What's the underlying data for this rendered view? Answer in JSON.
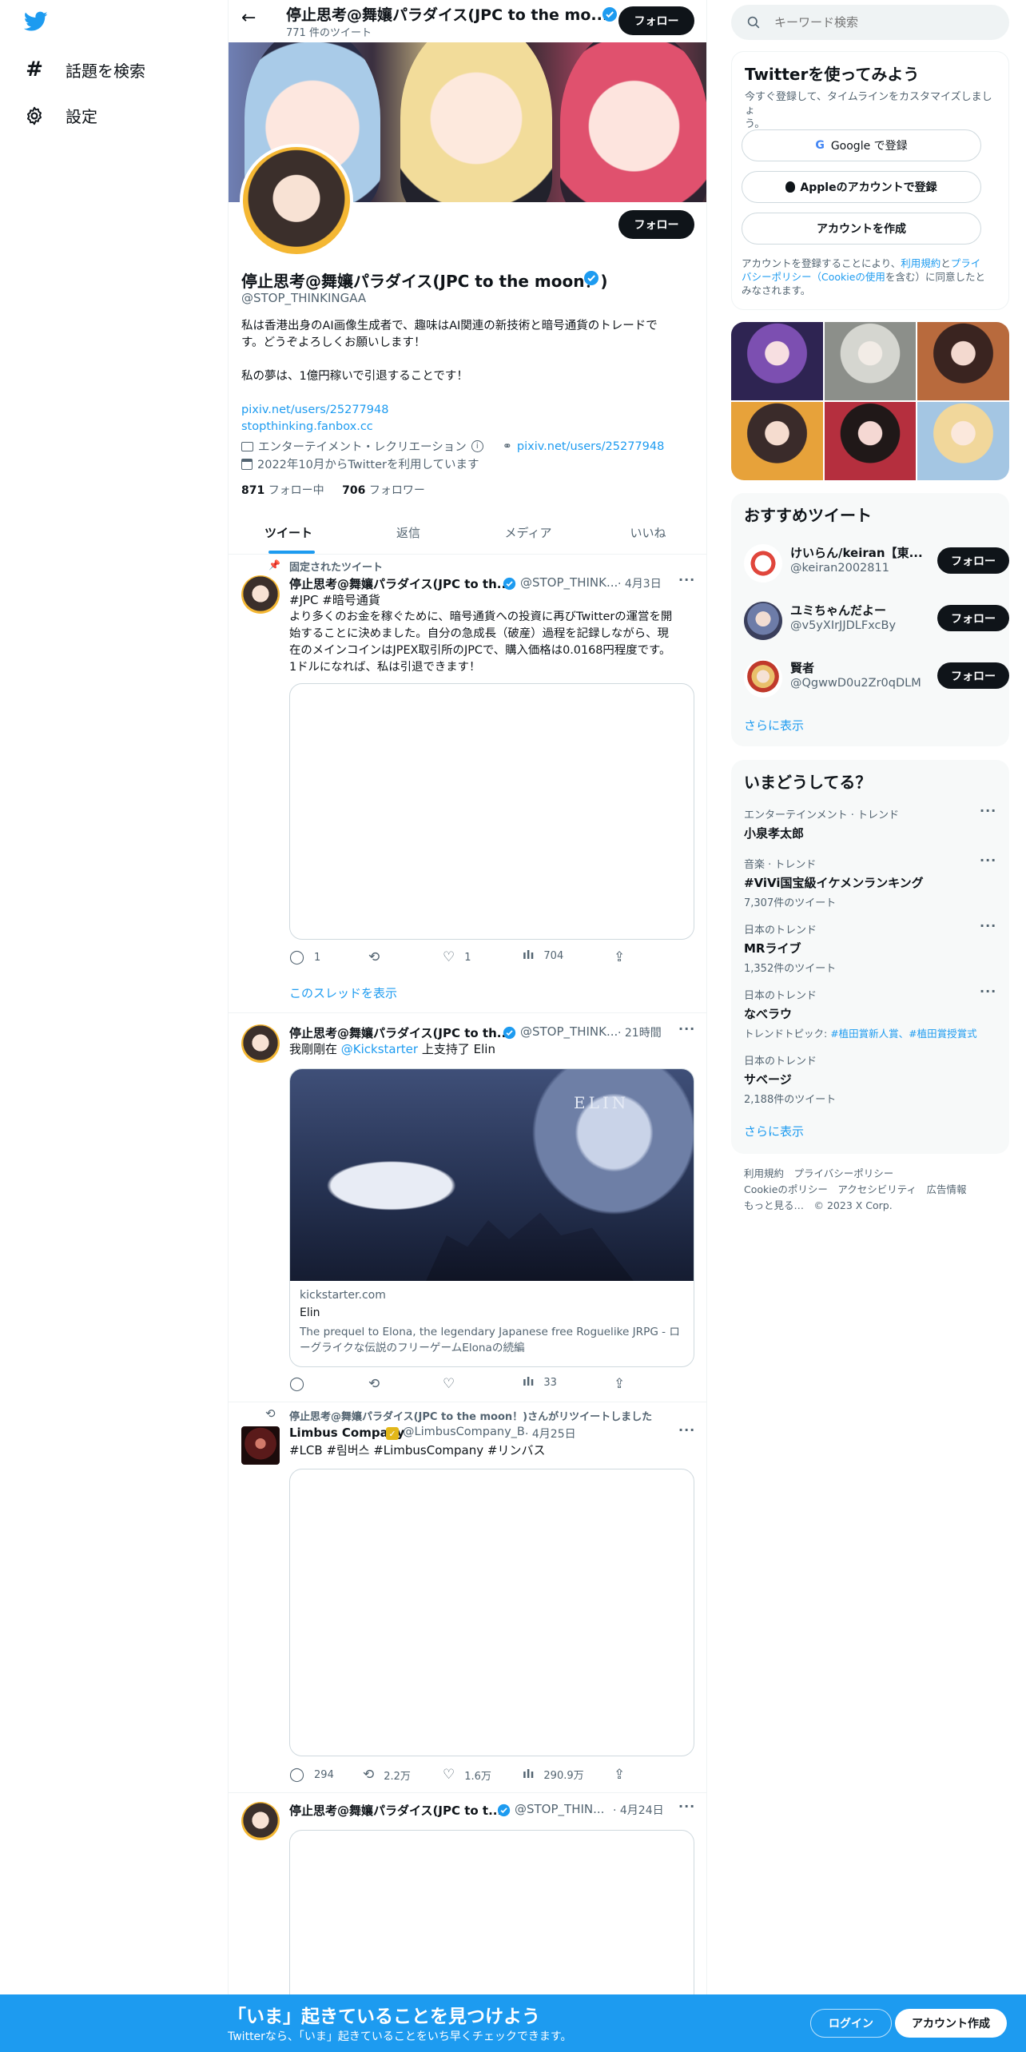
{
  "nav": {
    "explore_label": "話題を検索",
    "settings_label": "設定"
  },
  "header": {
    "name": "停止思考@舞孃パラダイス(JPC to the mo...",
    "tweet_count": "771 件のツイート",
    "follow_label": "フォロー"
  },
  "profile": {
    "follow_label": "フォロー",
    "name": "停止思考@舞孃パラダイス(JPC to the moon！)",
    "handle": "@STOP_THINKINGAA",
    "bio_line1": "私は香港出身のAI画像生成者で、趣味はAI関連の新技術と暗号通貨のトレードで",
    "bio_line2": "す。どうぞよろしくお願いします！",
    "bio_line3": "私の夢は、1億円稼いで引退することです！",
    "link1": "pixiv.net/users/25277948",
    "link2": "stopthinking.fanbox.cc",
    "category": "エンターテイメント・レクリエーション",
    "website": "pixiv.net/users/25277948",
    "joined": "2022年10月からTwitterを利用しています",
    "following_count": "871",
    "following_label": "フォロー中",
    "followers_count": "706",
    "followers_label": "フォロワー"
  },
  "tabs": [
    "ツイート",
    "返信",
    "メディア",
    "いいね"
  ],
  "tweets": [
    {
      "pinned_label": "固定されたツイート",
      "name": "停止思考@舞孃パラダイス(JPC to th...",
      "handle": "@STOP_THINK...",
      "time": "· 4月3日",
      "hashtags": "#JPC #暗号通貨",
      "text_line1": "より多くのお金を稼ぐために、暗号通貨への投資に再びTwitterの運営を開",
      "text_line2": "始することに決めました。自分の急成長（破産）過程を記録しながら、現",
      "text_line3": "在のメインコインはJPEX取引所のJPCで、購入価格は0.0168円程度です。",
      "text_line4": "1ドルになれば、私は引退できます！",
      "replies": "1",
      "likes": "1",
      "views": "704",
      "thread_link": "このスレッドを表示"
    },
    {
      "name": "停止思考@舞孃パラダイス(JPC to th...",
      "handle": "@STOP_THINK...",
      "time": "· 21時間",
      "text_prefix": "我剛剛在",
      "text_mention": "@Kickstarter",
      "text_suffix": "上支持了 Elin",
      "card_image_text": "ELIN",
      "card_domain": "kickstarter.com",
      "card_title": "Elin",
      "card_desc_line1": "The prequel to Elona, the legendary Japanese free Roguelike JRPG - ロ",
      "card_desc_line2": "ーグライクな伝説のフリーゲームElonaの続編",
      "views": "33"
    },
    {
      "retweet_label": "停止思考@舞孃パラダイス(JPC to the moon！)さんがリツイートしました",
      "name": "Limbus Company",
      "handle": "@LimbusCompany_B",
      "time": "· 4月25日",
      "hashtags": "#LCB #림버스 #LimbusCompany #リンバス",
      "replies": "294",
      "retweets": "2.2万",
      "likes": "1.6万",
      "views": "290.9万"
    },
    {
      "name": "停止思考@舞孃パラダイス(JPC to t...",
      "handle": "@STOP_THIN...",
      "time": "· 4月24日"
    }
  ],
  "search": {
    "placeholder": "キーワード検索"
  },
  "signup": {
    "title": "Twitterを使ってみよう",
    "subtitle_line1": "今すぐ登録して、タイムラインをカスタマイズしましょ",
    "subtitle_line2": "う。",
    "google_label": "Google で登録",
    "apple_label": "Appleのアカウントで登録",
    "create_label": "アカウントを作成",
    "legal_line1_a": "アカウントを登録することにより、",
    "legal_line1_b": "利用規約",
    "legal_line1_c": "と",
    "legal_line1_d": "プライ",
    "legal_line2_a": "バシーポリシー（Cookieの使用",
    "legal_line2_b": "を含む）に同意したと",
    "legal_line3": "みなされます。"
  },
  "recommended": {
    "title": "おすすめツイート",
    "users": [
      {
        "name": "けいらん/keiran【東...",
        "handle": "@keiran2002811",
        "follow": "フォロー"
      },
      {
        "name": "ユミちゃんだよー",
        "handle": "@v5yXIrJJDLFxcBy",
        "follow": "フォロー"
      },
      {
        "name": "賢者",
        "handle": "@QgwwD0u2Zr0qDLM",
        "follow": "フォロー"
      }
    ],
    "show_more": "さらに表示"
  },
  "trends": {
    "title": "いまどうしてる？",
    "items": [
      {
        "context": "エンターテインメント · トレンド",
        "title": "小泉孝太郎",
        "meta": ""
      },
      {
        "context": "音楽 · トレンド",
        "title": "#ViVi国宝級イケメンランキング",
        "meta": "7,307件のツイート"
      },
      {
        "context": "日本のトレンド",
        "title": "MRライブ",
        "meta": "1,352件のツイート"
      },
      {
        "context": "日本のトレンド",
        "title": "なべラウ",
        "meta_prefix": "トレンドトピック: ",
        "meta_link": "#植田賞新人賞、#植田賞授賞式"
      },
      {
        "context": "日本のトレンド",
        "title": "サベージ",
        "meta": "2,188件のツイート"
      }
    ],
    "show_more": "さらに表示"
  },
  "footer": {
    "line1": "利用規約　プライバシーポリシー",
    "line2": "Cookieのポリシー　アクセシビリティ　広告情報",
    "line3": "もっと見る…　© 2023 X Corp."
  },
  "banner": {
    "title": "「いま」起きていることを見つけよう",
    "subtitle": "Twitterなら、「いま」起きていることをいち早くチェックできます。",
    "login_label": "ログイン",
    "signup_label": "アカウント作成"
  },
  "colors": {
    "brand": "#1d9bf0",
    "dark": "#0f1419",
    "gray": "#536471",
    "verified": "#1d9bf0",
    "gold_badge": "#e2b719"
  }
}
